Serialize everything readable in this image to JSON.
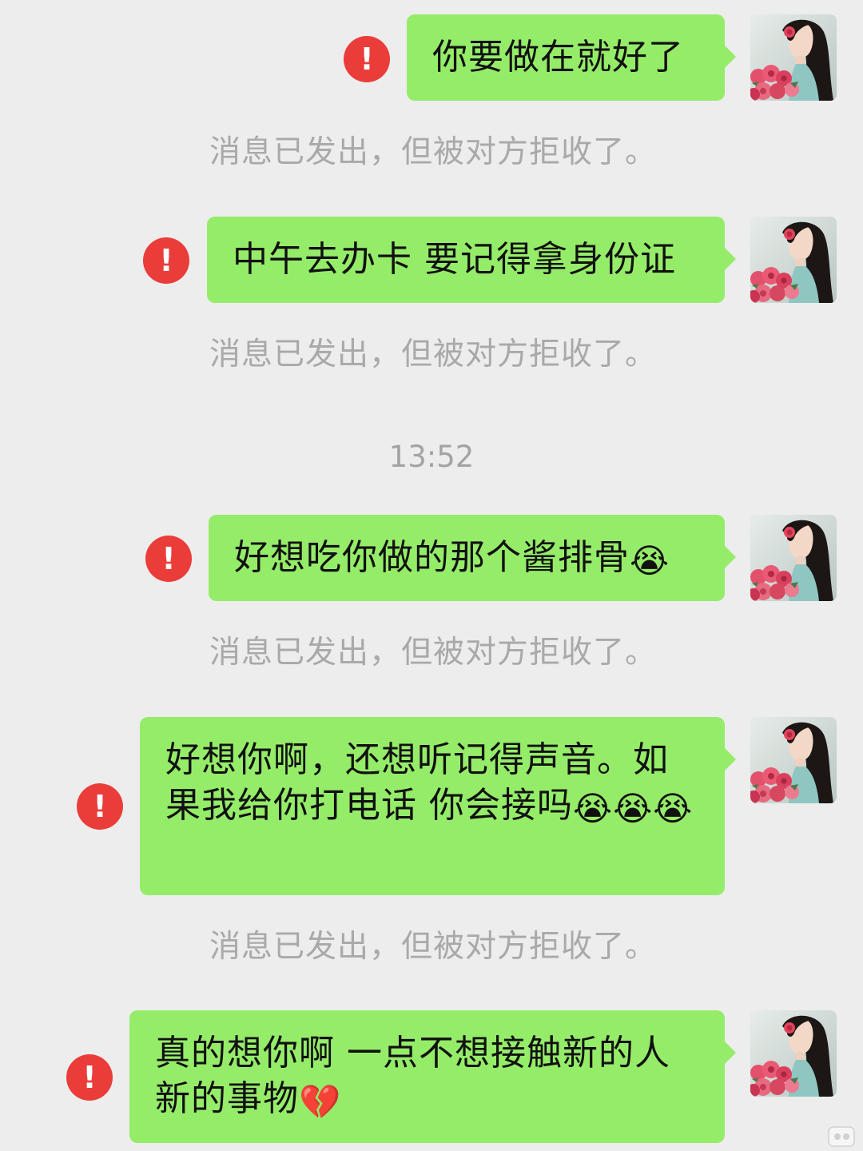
{
  "messages": [
    {
      "text": "你要做在就好了",
      "emoji": "",
      "status": "!",
      "notice": "消息已发出，但被对方拒收了。"
    },
    {
      "text": "中午去办卡 要记得拿身份证",
      "emoji": "",
      "status": "!",
      "notice": "消息已发出，但被对方拒收了。"
    },
    {
      "text": "好想吃你做的那个酱排骨",
      "emoji": "😭",
      "status": "!",
      "notice": "消息已发出，但被对方拒收了。"
    },
    {
      "text": "好想你啊，还想听记得声音。如果我给你打电话 你会接吗",
      "emoji": "😭😭😭",
      "status": "!",
      "notice": "消息已发出，但被对方拒收了。"
    },
    {
      "text": "真的想你啊 一点不想接触新的人新的事物",
      "emoji": "💔",
      "status": "!",
      "notice": ""
    }
  ],
  "timestamp": "13:52",
  "colors": {
    "background": "#ededed",
    "bubble": "#95ec69",
    "error": "#ea3d3a",
    "notice_text": "#a9a9a9"
  },
  "icons": {
    "status": "error-icon",
    "avatar": "avatar-girl-with-roses",
    "watermark": "watermark-logo"
  }
}
